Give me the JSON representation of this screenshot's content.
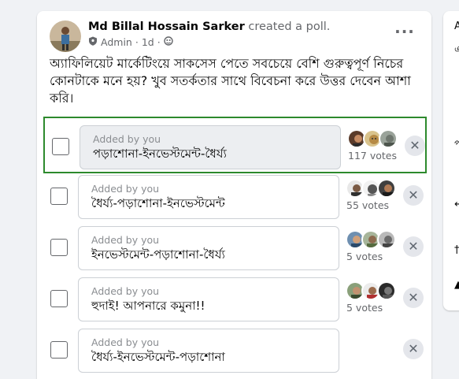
{
  "post": {
    "author": "Md Billal Hossain Sarker",
    "action": "created a poll.",
    "role": "Admin",
    "time": "1d",
    "sep": "·",
    "more": "···",
    "text": "অ্যাফিলিয়েট মার্কেটিংয়ে সাকসেস পেতে সবচেয়ে বেশি গুরুত্বপূর্ণ নিচের কোনটাকে মনে হয়? খুব সতর্কতার সাথে বিবেচনা করে উত্তর দেবেন আশা করি।"
  },
  "poll": {
    "options": [
      {
        "added": "Added by you",
        "label": "পড়াশোনা-ইনভেস্টমেন্ট-ধৈর্য্য",
        "votes": "117 votes",
        "selected": true
      },
      {
        "added": "Added by you",
        "label": "ধৈর্য্য-পড়াশোনা-ইনভেস্টমেন্ট",
        "votes": "55 votes",
        "selected": false
      },
      {
        "added": "Added by you",
        "label": "ইনভেস্টমেন্ট-পড়াশোনা-ধৈর্য্য",
        "votes": "5 votes",
        "selected": false
      },
      {
        "added": "Added by you",
        "label": "হুদাই! আপনারে কমুনা!!",
        "votes": "5 votes",
        "selected": false
      },
      {
        "added": "Added by you",
        "label": "ধৈর্য্য-ইনভেস্টমেন্ট-পড়াশোনা",
        "votes": "",
        "selected": false
      }
    ],
    "remove_glyph": "✕"
  },
  "right_panel": {
    "glyphs": [
      "A",
      "এ",
      "প",
      "↵",
      "†",
      "▲"
    ]
  },
  "colors": {
    "selected_border": "#2d8a2d",
    "page_bg": "#f0f2f5"
  }
}
